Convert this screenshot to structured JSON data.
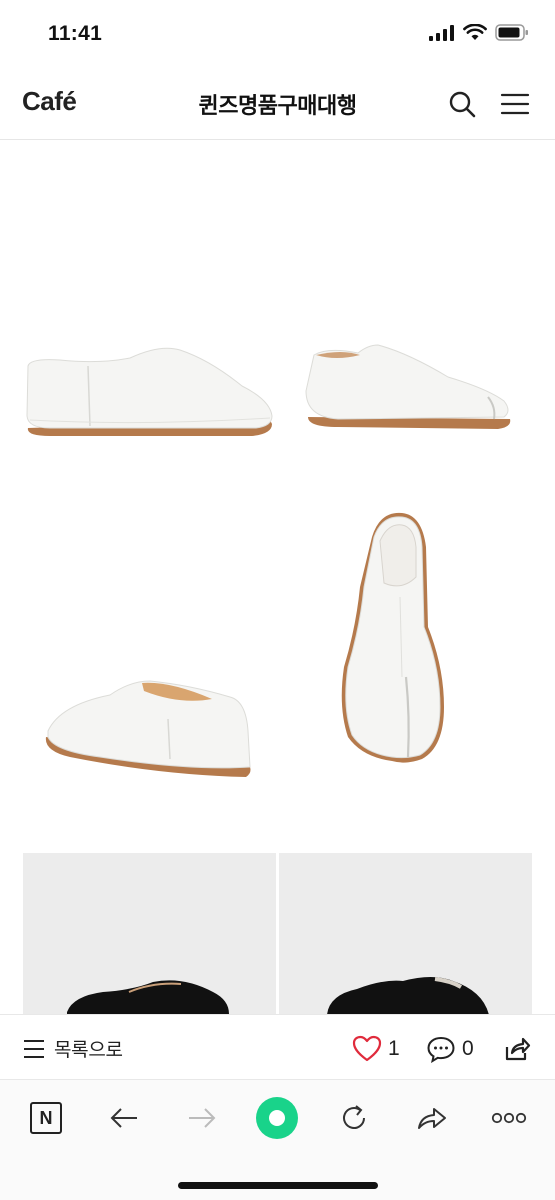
{
  "status_bar": {
    "time": "11:41"
  },
  "header": {
    "logo": "Café",
    "cafe_name": "퀸즈명품구매대행"
  },
  "post_bar": {
    "list_label": "목록으로",
    "like_count": "1",
    "comment_count": "0"
  },
  "browser_toolbar": {
    "naver_badge": "N"
  },
  "colors": {
    "heart": "#e02b3c",
    "green_button": "#19d38a",
    "sole": "#b57a4c",
    "leather": "#f5f5f3",
    "suede": "#111111"
  },
  "icons": [
    "signal-icon",
    "wifi-icon",
    "battery-icon",
    "search-icon",
    "menu-icon",
    "heart-icon",
    "comment-icon",
    "share-icon",
    "back-icon",
    "forward-icon",
    "refresh-icon",
    "send-icon",
    "more-icon"
  ]
}
